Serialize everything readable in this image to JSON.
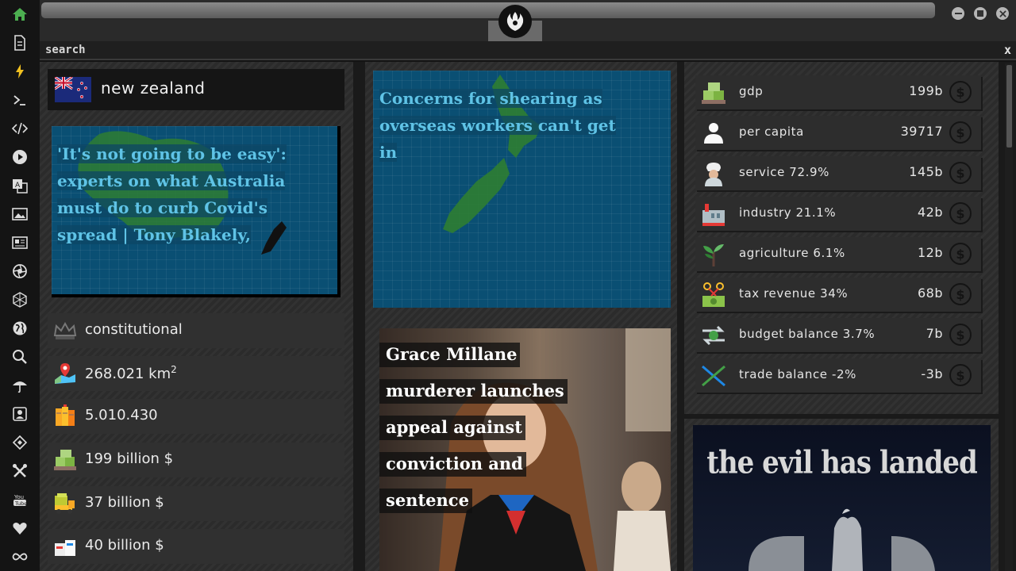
{
  "search": {
    "label": "search",
    "close": "x"
  },
  "country": {
    "name": "new zealand"
  },
  "stats": [
    {
      "icon": "crown-icon",
      "text": "constitutional"
    },
    {
      "icon": "map-pin-icon",
      "text": "268.021 km",
      "sup": "2"
    },
    {
      "icon": "population-icon",
      "text": "5.010.430"
    },
    {
      "icon": "money-stack-icon",
      "text": "199 billion $"
    },
    {
      "icon": "money-truck-icon",
      "text": "37 billion $"
    },
    {
      "icon": "boxes-icon",
      "text": "40 billion $"
    }
  ],
  "news": {
    "left_headline": "'It's not going to be easy': experts on what Australia must do to curb Covid's spread | Tony Blakely,",
    "mid_headline": "Concerns for shearing as overseas workers can't get in",
    "photo_headline": "Grace Millane murderer launches appeal against conviction and sentence"
  },
  "economy": [
    {
      "icon": "money-stack-icon",
      "label": "gdp",
      "value": "199b"
    },
    {
      "icon": "person-icon",
      "label": "per capita",
      "value": "39717"
    },
    {
      "icon": "chef-icon",
      "label": "service 72.9%",
      "value": "145b"
    },
    {
      "icon": "factory-icon",
      "label": "industry 21.1%",
      "value": "42b"
    },
    {
      "icon": "plant-icon",
      "label": "agriculture 6.1%",
      "value": "12b"
    },
    {
      "icon": "scissors-money-icon",
      "label": "tax revenue 34%",
      "value": "68b"
    },
    {
      "icon": "exchange-icon",
      "label": "budget balance 3.7%",
      "value": "7b"
    },
    {
      "icon": "trade-cross-icon",
      "label": "trade balance -2%",
      "value": "-3b"
    }
  ],
  "dollar_symbol": "$",
  "ad": {
    "tagline": "the evil has landed"
  },
  "colors": {
    "map_blue": "#0a4f73",
    "headline_blue": "#5fc3e6",
    "land_green": "#2e7d32"
  }
}
